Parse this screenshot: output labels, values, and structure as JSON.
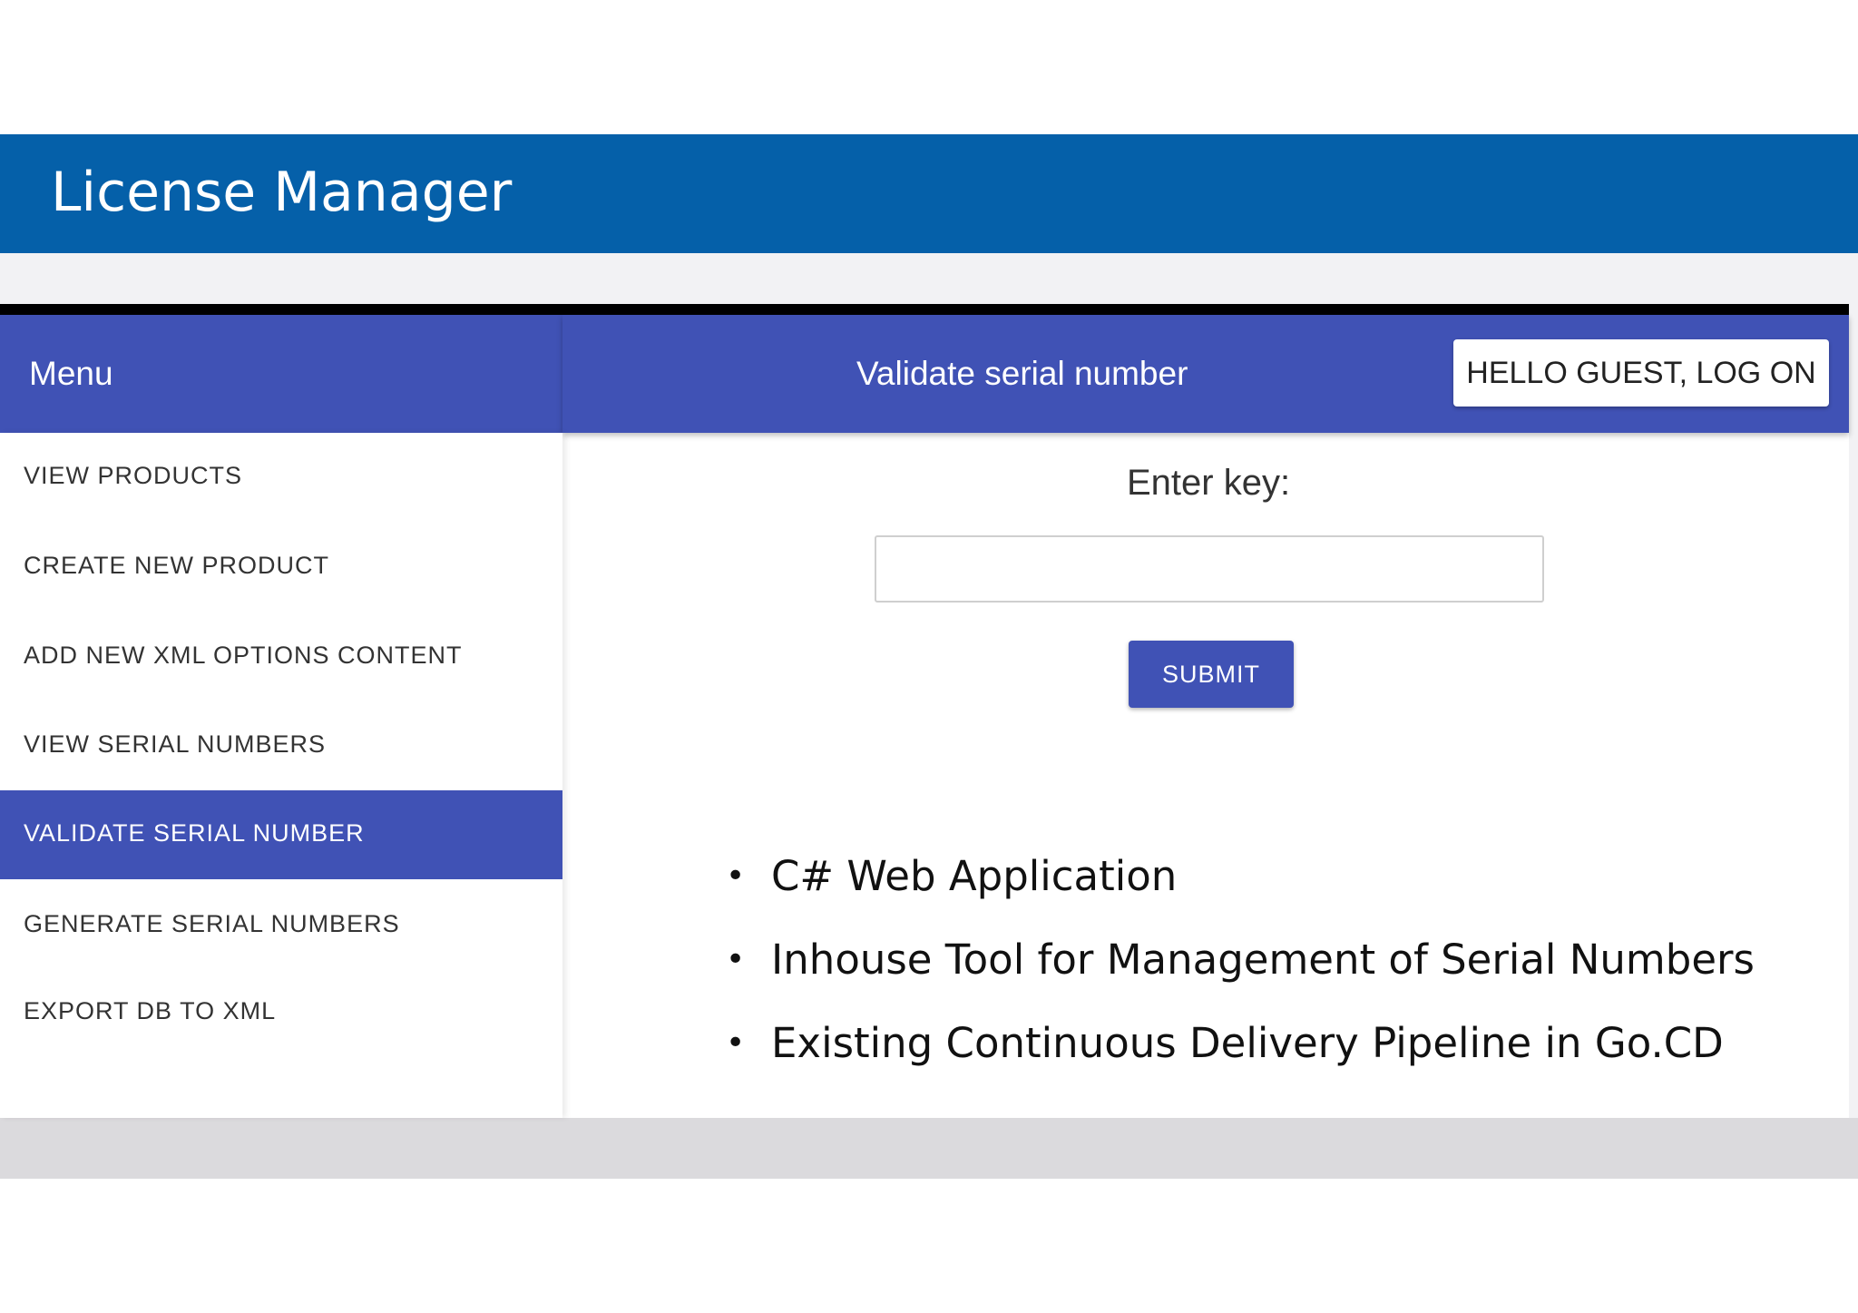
{
  "slide": {
    "title": "License Manager"
  },
  "app": {
    "sidebar_header": "Menu",
    "header_title": "Validate serial number",
    "logon_button": "HELLO GUEST, LOG ON",
    "menu_items": [
      {
        "label": "VIEW PRODUCTS",
        "active": false
      },
      {
        "label": "CREATE NEW PRODUCT",
        "active": false
      },
      {
        "label": "ADD NEW XML OPTIONS CONTENT",
        "active": false
      },
      {
        "label": "VIEW SERIAL NUMBERS",
        "active": false
      },
      {
        "label": "VALIDATE SERIAL NUMBER",
        "active": true
      },
      {
        "label": "GENERATE SERIAL NUMBERS",
        "active": false
      },
      {
        "label": "EXPORT DB TO XML",
        "active": false
      }
    ],
    "form": {
      "enter_key_label": "Enter key:",
      "key_value": "",
      "submit_label": "SUBMIT"
    }
  },
  "bullets": [
    "C# Web Application",
    "Inhouse Tool for Management of Serial Numbers",
    "Existing Continuous Delivery Pipeline in Go.CD"
  ],
  "colors": {
    "title_bar": "#0560a9",
    "app_accent": "#4052b5",
    "bottom_strip": "#dbdadd"
  }
}
